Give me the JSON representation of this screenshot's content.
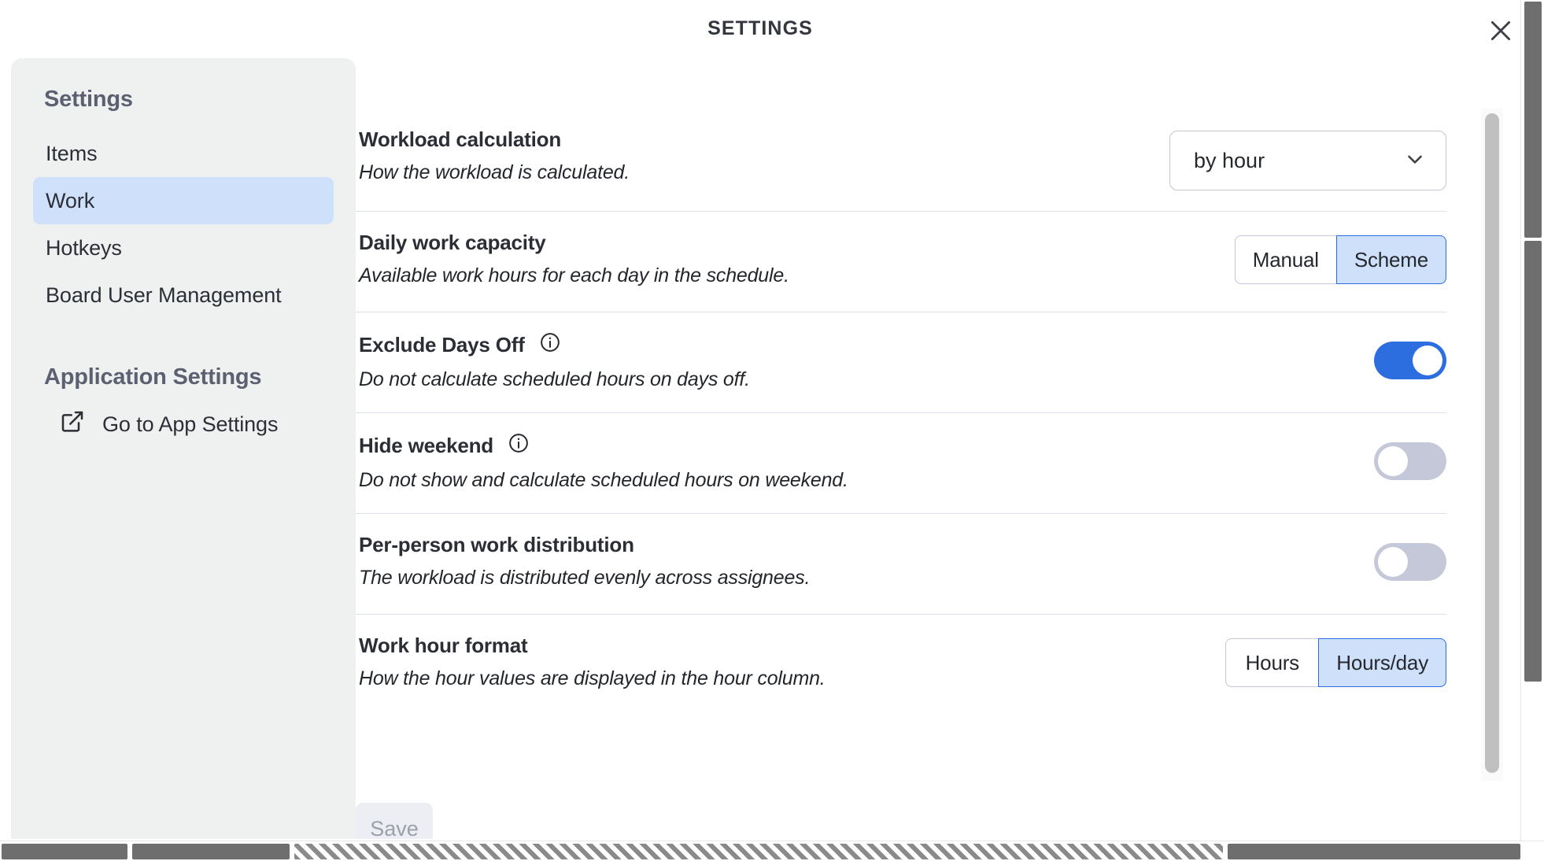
{
  "header": {
    "title": "SETTINGS",
    "close_icon": "close-icon"
  },
  "sidebar": {
    "heading": "Settings",
    "items": [
      {
        "label": "Items",
        "active": false
      },
      {
        "label": "Work",
        "active": true
      },
      {
        "label": "Hotkeys",
        "active": false
      },
      {
        "label": "Board User Management",
        "active": false
      }
    ],
    "section_heading": "Application Settings",
    "app_settings_link": {
      "label": "Go to App Settings",
      "icon": "external-link-icon"
    }
  },
  "main": {
    "rows": [
      {
        "label": "Workload calculation",
        "description": "How the workload is calculated.",
        "control": "select",
        "has_info": false,
        "select_value": "by hour",
        "chevron_icon": "chevron-down-icon"
      },
      {
        "label": "Daily work capacity",
        "description": "Available work hours for each day in the schedule.",
        "control": "segmented",
        "has_info": false,
        "options": [
          "Manual",
          "Scheme"
        ],
        "selected": "Scheme"
      },
      {
        "label": "Exclude Days Off",
        "description": "Do not calculate scheduled hours on days off.",
        "control": "switch",
        "has_info": true,
        "info_icon": "info-icon",
        "switch_on": true
      },
      {
        "label": "Hide weekend",
        "description": "Do not show and calculate scheduled hours on weekend.",
        "control": "switch",
        "has_info": true,
        "info_icon": "info-icon",
        "switch_on": false
      },
      {
        "label": "Per-person work distribution",
        "description": "The workload is distributed evenly across assignees.",
        "control": "switch",
        "has_info": false,
        "switch_on": false
      },
      {
        "label": "Work hour format",
        "description": "How the hour values are displayed in the hour column.",
        "control": "segmented",
        "has_info": false,
        "options": [
          "Hours",
          "Hours/day"
        ],
        "selected": "Hours/day"
      }
    ],
    "save_label": "Save"
  },
  "colors": {
    "accent_blue": "#2c6ddf",
    "accent_blue_light": "#cfe0fb",
    "switch_off": "#c4c8d8",
    "sidebar_bg": "#eff0f0",
    "divider": "#dcdfe8",
    "text_primary": "#2b2e34",
    "text_muted": "#5c6070",
    "save_disabled_text": "#9ca0a8"
  }
}
